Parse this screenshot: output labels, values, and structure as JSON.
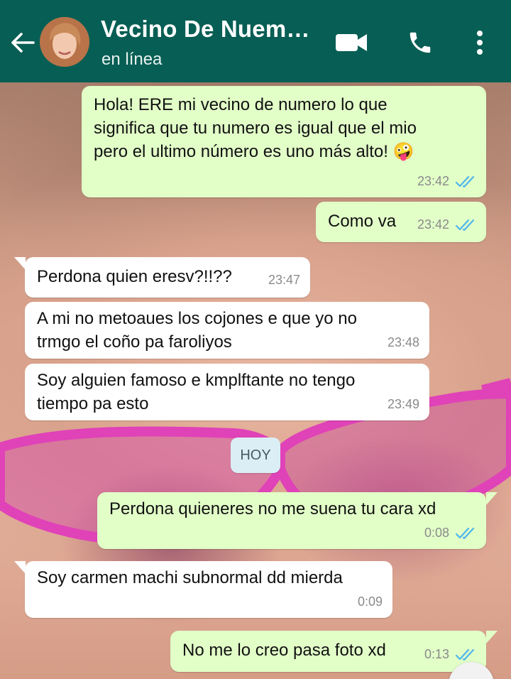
{
  "header": {
    "contact_name": "Vecino De Nuem…",
    "status": "en línea",
    "background": "#075e54"
  },
  "colors": {
    "outgoing_bubble": "#e2ffc8",
    "incoming_bubble": "#ffffff",
    "read_ticks": "#4fb6ec",
    "date_chip": "#dbeef6"
  },
  "messages": [
    {
      "direction": "out",
      "lines": [
        "Hola! ERE mi vecino de numero lo que",
        "significa que tu numero es igual que el mio",
        "pero el ultimo número es uno más alto! 🤪"
      ],
      "time": "23:42",
      "read": true
    },
    {
      "direction": "out",
      "lines": [
        "Como va"
      ],
      "time": "23:42",
      "read": true
    },
    {
      "direction": "in",
      "lines": [
        "Perdona quien eresv?!!??"
      ],
      "time": "23:47"
    },
    {
      "direction": "in",
      "lines": [
        "A mi no metoaues los cojones e que yo no",
        "trmgo el coño pa faroliyos"
      ],
      "time": "23:48"
    },
    {
      "direction": "in",
      "lines": [
        "Soy alguien famoso e kmplftante no tengo",
        "tiempo pa esto"
      ],
      "time": "23:49"
    },
    {
      "direction": "out",
      "lines": [
        "Perdona quieneres no me suena tu cara xd"
      ],
      "time": "0:08",
      "read": true
    },
    {
      "direction": "in",
      "lines": [
        "Soy carmen machi subnormal dd mierda"
      ],
      "time": "0:09"
    },
    {
      "direction": "out",
      "lines": [
        "No me lo creo pasa foto xd"
      ],
      "time": "0:13",
      "read": true
    }
  ],
  "date_separator": "HOY"
}
